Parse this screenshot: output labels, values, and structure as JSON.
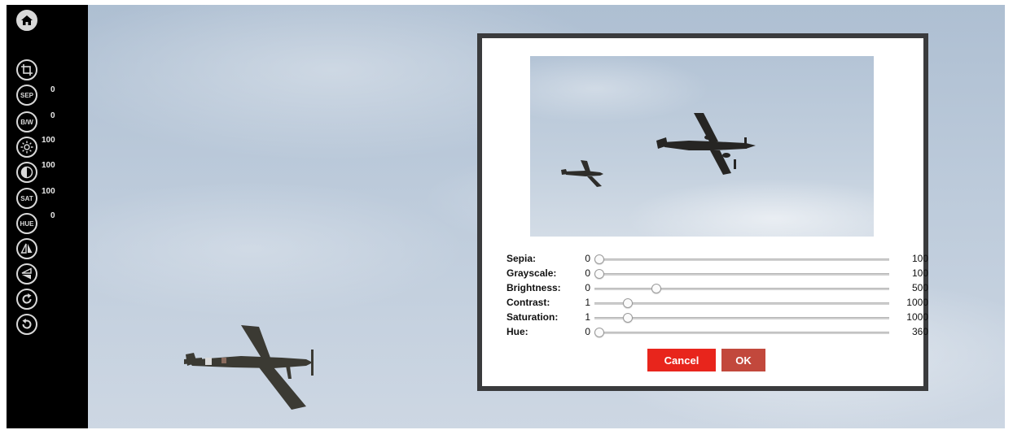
{
  "toolbar": {
    "items": [
      {
        "name": "home-icon",
        "glyph": ""
      },
      {
        "name": "crop-icon",
        "glyph": ""
      },
      {
        "name": "sepia-button",
        "glyph": "SEP",
        "value": "0"
      },
      {
        "name": "grayscale-button",
        "glyph": "B/W",
        "value": "0"
      },
      {
        "name": "brightness-button",
        "glyph": "",
        "value": "100"
      },
      {
        "name": "contrast-button",
        "glyph": "",
        "value": "100"
      },
      {
        "name": "saturation-button",
        "glyph": "SAT",
        "value": "100"
      },
      {
        "name": "hue-button",
        "glyph": "HUE",
        "value": "0"
      },
      {
        "name": "flip-horizontal-icon",
        "glyph": ""
      },
      {
        "name": "flip-vertical-icon",
        "glyph": ""
      },
      {
        "name": "rotate-clockwise-icon",
        "glyph": ""
      },
      {
        "name": "rotate-counterclockwise-icon",
        "glyph": ""
      }
    ]
  },
  "dialog": {
    "sliders": [
      {
        "label": "Sepia:",
        "min": "0",
        "max": "100",
        "value": 0
      },
      {
        "label": "Grayscale:",
        "min": "0",
        "max": "100",
        "value": 0
      },
      {
        "label": "Brightness:",
        "min": "0",
        "max": "500",
        "value": 100
      },
      {
        "label": "Contrast:",
        "min": "1",
        "max": "1000",
        "value": 100
      },
      {
        "label": "Saturation:",
        "min": "1",
        "max": "1000",
        "value": 100
      },
      {
        "label": "Hue:",
        "min": "0",
        "max": "360",
        "value": 0
      }
    ],
    "cancel_label": "Cancel",
    "ok_label": "OK"
  },
  "colors": {
    "toolbar_bg": "#000000",
    "cancel": "#e8251c",
    "ok": "#c2483c",
    "dialog_border": "#3a3b3d"
  }
}
